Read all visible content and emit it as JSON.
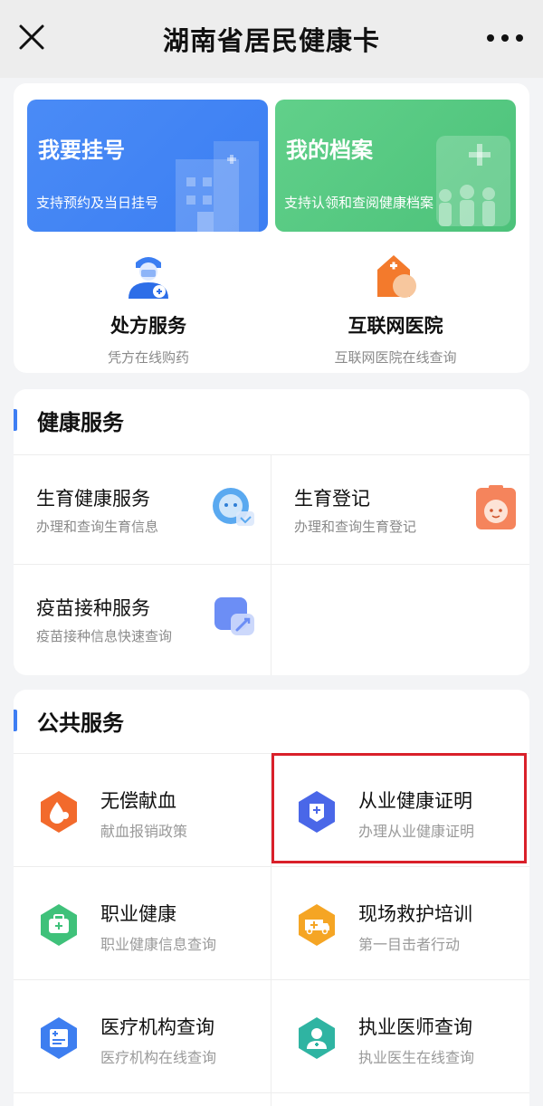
{
  "nav": {
    "title": "湖南省居民健康卡",
    "close_icon": "close-icon",
    "more_icon": "more-icon"
  },
  "top": {
    "banners": [
      {
        "title": "我要挂号",
        "subtitle": "支持预约及当日挂号",
        "color": "#3b7ef2",
        "icon": "hospital-building-icon"
      },
      {
        "title": "我的档案",
        "subtitle": "支持认领和查阅健康档案",
        "color": "#4cc27a",
        "icon": "family-record-icon"
      }
    ],
    "services": [
      {
        "title": "处方服务",
        "subtitle": "凭方在线购药",
        "icon": "doctor-icon"
      },
      {
        "title": "互联网医院",
        "subtitle": "互联网医院在线查询",
        "icon": "online-hospital-icon"
      }
    ]
  },
  "health": {
    "heading": "健康服务",
    "items": [
      {
        "title": "生育健康服务",
        "subtitle": "办理和查询生育信息",
        "icon": "baby-card-icon"
      },
      {
        "title": "生育登记",
        "subtitle": "办理和查询生育登记",
        "icon": "birth-registration-icon"
      },
      {
        "title": "疫苗接种服务",
        "subtitle": "疫苗接种信息快速查询",
        "icon": "vaccine-icon"
      }
    ]
  },
  "public": {
    "heading": "公共服务",
    "items": [
      {
        "title": "无偿献血",
        "subtitle": "献血报销政策",
        "icon": "blood-drop-icon",
        "color": "#f26a2c"
      },
      {
        "title": "从业健康证明",
        "subtitle": "办理从业健康证明",
        "icon": "health-certificate-icon",
        "color": "#4a67e8"
      },
      {
        "title": "职业健康",
        "subtitle": "职业健康信息查询",
        "icon": "medical-kit-icon",
        "color": "#3fc17a"
      },
      {
        "title": "现场救护培训",
        "subtitle": "第一目击者行动",
        "icon": "ambulance-icon",
        "color": "#f5a524"
      },
      {
        "title": "医疗机构查询",
        "subtitle": "医疗机构在线查询",
        "icon": "hospital-id-icon",
        "color": "#3d7ef0"
      },
      {
        "title": "执业医师查询",
        "subtitle": "执业医生在线查询",
        "icon": "physician-icon",
        "color": "#2fb4a2"
      }
    ]
  },
  "colors": {
    "accent": "#3e7ef3",
    "highlight_border": "#d9202a"
  }
}
